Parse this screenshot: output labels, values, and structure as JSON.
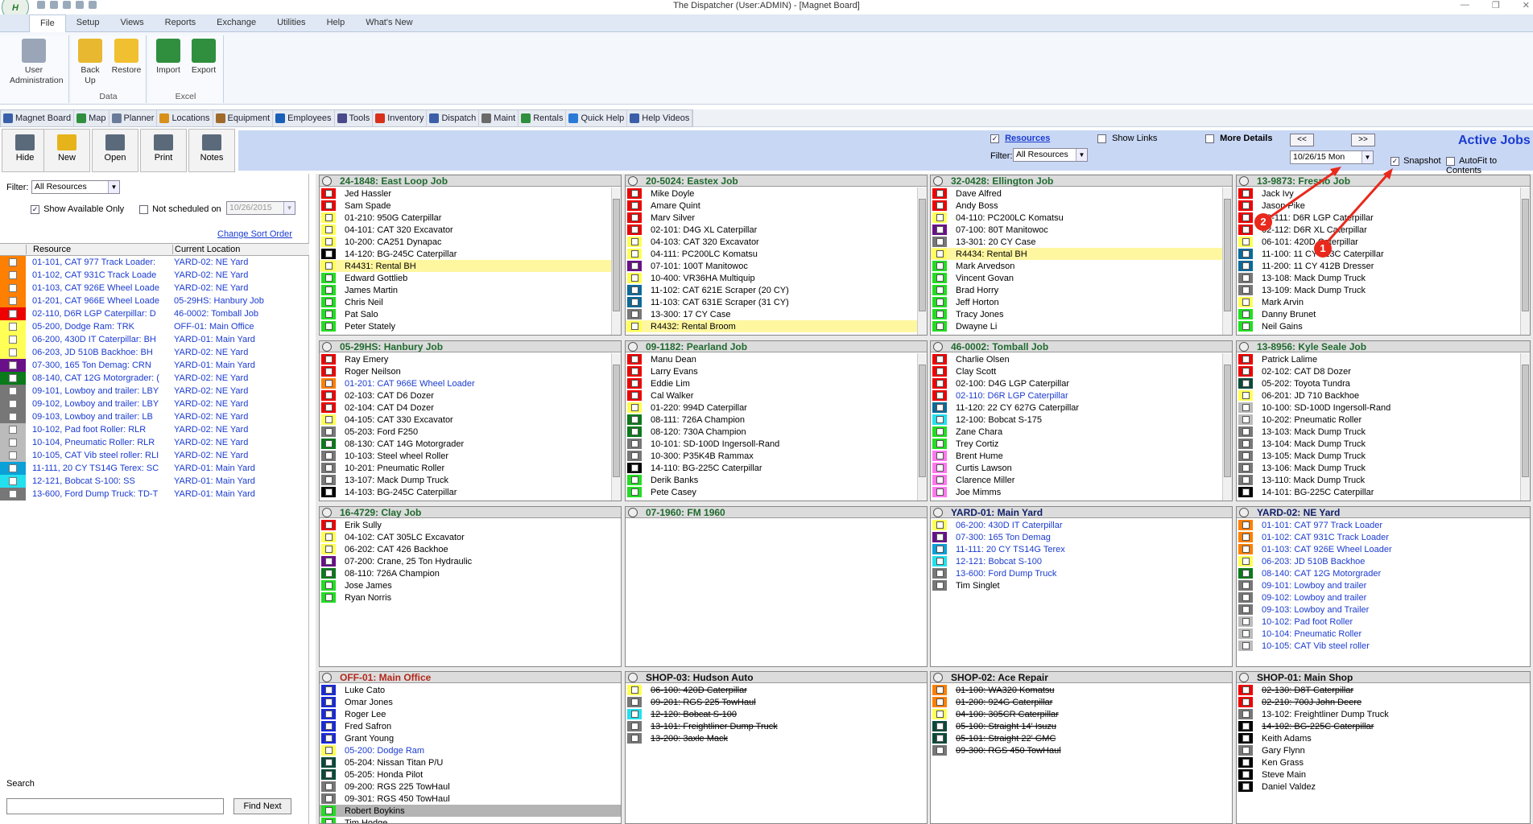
{
  "window": {
    "title": "The Dispatcher (User:ADMIN) - [Magnet Board]",
    "logo": "H"
  },
  "ribbon_tabs": [
    {
      "label": "File",
      "active": true
    },
    {
      "label": "Setup"
    },
    {
      "label": "Views"
    },
    {
      "label": "Reports"
    },
    {
      "label": "Exchange"
    },
    {
      "label": "Utilities"
    },
    {
      "label": "Help"
    },
    {
      "label": "What's New"
    }
  ],
  "ribbon": {
    "user_admin": "User Administration",
    "backup": "Back Up",
    "restore": "Restore",
    "group_data": "Data",
    "import": "Import",
    "export": "Export",
    "group_excel": "Excel"
  },
  "nav": [
    "Magnet Board",
    "Map",
    "Planner",
    "Locations",
    "Equipment",
    "Employees",
    "Tools",
    "Inventory",
    "Dispatch",
    "Maint",
    "Rentals",
    "Quick Help",
    "Help Videos"
  ],
  "toolbar": {
    "hide": "Hide",
    "new": "New",
    "open": "Open",
    "print": "Print",
    "notes": "Notes"
  },
  "header": {
    "resources_label": "Resources",
    "show_links": "Show Links",
    "more_details": "More Details",
    "filter_label": "Filter:",
    "filter_value": "All Resources",
    "prev": "<<",
    "next": ">>",
    "date": "10/26/15 Mon",
    "active_jobs": "Active Jobs",
    "snapshot": "Snapshot",
    "autofit": "AutoFit to Contents"
  },
  "annotations": [
    "1",
    "2"
  ],
  "left": {
    "filter_label": "Filter:",
    "filter_value": "All Resources",
    "show_available": "Show Available Only",
    "not_scheduled": "Not scheduled on",
    "not_scheduled_date": "10/26/2015",
    "change_sort": "Change Sort Order",
    "col_resource": "Resource",
    "col_location": "Current Location",
    "search_label": "Search",
    "find_next": "Find Next",
    "rows": [
      {
        "c": "#ff7f00",
        "name": "01-101, CAT 977 Track Loader:",
        "loc": "YARD-02: NE Yard"
      },
      {
        "c": "#ff7f00",
        "name": "01-102, CAT 931C Track Loade",
        "loc": "YARD-02: NE Yard"
      },
      {
        "c": "#ff7f00",
        "name": "01-103, CAT 926E Wheel Loade",
        "loc": "YARD-02: NE Yard"
      },
      {
        "c": "#ff7f00",
        "name": "01-201, CAT 966E Wheel Loade",
        "loc": "05-29HS: Hanbury Job"
      },
      {
        "c": "#ee0000",
        "name": "02-110, D6R LGP Caterpillar: D",
        "loc": "46-0002: Tomball Job"
      },
      {
        "c": "#ffff55",
        "name": "05-200, Dodge Ram: TRK",
        "loc": "OFF-01: Main Office"
      },
      {
        "c": "#ffff55",
        "name": "06-200, 430D IT Caterpillar: BH",
        "loc": "YARD-01: Main Yard"
      },
      {
        "c": "#ffff55",
        "name": "06-203, JD 510B Backhoe: BH",
        "loc": "YARD-02: NE Yard"
      },
      {
        "c": "#6a0f8a",
        "name": "07-300, 165 Ton Demag: CRN",
        "loc": "YARD-01: Main Yard"
      },
      {
        "c": "#0a7a1a",
        "name": "08-140, CAT 12G Motorgrader: (",
        "loc": "YARD-02: NE Yard"
      },
      {
        "c": "#777777",
        "name": "09-101, Lowboy and trailer: LBY",
        "loc": "YARD-02: NE Yard"
      },
      {
        "c": "#777777",
        "name": "09-102, Lowboy and trailer: LBY",
        "loc": "YARD-02: NE Yard"
      },
      {
        "c": "#777777",
        "name": "09-103, Lowboy and trailer: LB",
        "loc": "YARD-02: NE Yard"
      },
      {
        "c": "#bbbbbb",
        "name": "10-102, Pad foot Roller: RLR",
        "loc": "YARD-02: NE Yard"
      },
      {
        "c": "#bbbbbb",
        "name": "10-104, Pneumatic Roller: RLR",
        "loc": "YARD-02: NE Yard"
      },
      {
        "c": "#bbbbbb",
        "name": "10-105, CAT Vib steel roller: RLI",
        "loc": "YARD-02: NE Yard"
      },
      {
        "c": "#0aa0d8",
        "name": "11-111, 20 CY TS14G Terex: SC",
        "loc": "YARD-01: Main Yard"
      },
      {
        "c": "#22e0ee",
        "name": "12-121, Bobcat S-100: SS",
        "loc": "YARD-01: Main Yard"
      },
      {
        "c": "#777777",
        "name": "13-600, Ford Dump Truck: TD-T",
        "loc": "YARD-01: Main Yard"
      }
    ]
  },
  "jobs": [
    {
      "title": "24-1848: East Loop Job",
      "style": "green",
      "scroll": true,
      "rows": [
        {
          "c": "#ee0000",
          "t": "Jed Hassler"
        },
        {
          "c": "#ee0000",
          "t": "Sam Spade"
        },
        {
          "c": "#ffff55",
          "t": "01-210: 950G Caterpillar"
        },
        {
          "c": "#ffff55",
          "t": "04-101: CAT 320 Excavator"
        },
        {
          "c": "#ffff55",
          "t": "10-200: CA251 Dynapac"
        },
        {
          "c": "#000000",
          "t": "14-120: BG-245C Caterpillar"
        },
        {
          "c": "#ffff55",
          "t": "R4431: Rental BH",
          "hl": true
        },
        {
          "c": "#22dd22",
          "t": "Edward Gottlieb"
        },
        {
          "c": "#22dd22",
          "t": "James Martin"
        },
        {
          "c": "#22dd22",
          "t": "Chris Neil"
        },
        {
          "c": "#22dd22",
          "t": "Pat Salo"
        },
        {
          "c": "#22dd22",
          "t": "Peter Stately"
        }
      ]
    },
    {
      "title": "20-5024: Eastex Job",
      "style": "green",
      "scroll": true,
      "rows": [
        {
          "c": "#ee0000",
          "t": "Mike Doyle"
        },
        {
          "c": "#ee0000",
          "t": "Amare Quint"
        },
        {
          "c": "#ee0000",
          "t": "Marv Silver"
        },
        {
          "c": "#ee0000",
          "t": "02-101: D4G XL Caterpillar"
        },
        {
          "c": "#ffff55",
          "t": "04-103: CAT 320 Excavator"
        },
        {
          "c": "#ffff55",
          "t": "04-111: PC200LC Komatsu"
        },
        {
          "c": "#6a0f8a",
          "t": "07-101: 100T Manitowoc"
        },
        {
          "c": "#ffff55",
          "t": "10-400: VR36HA Multiquip"
        },
        {
          "c": "#0a6a9a",
          "t": "11-102: CAT 621E Scraper (20 CY)"
        },
        {
          "c": "#0a6a9a",
          "t": "11-103: CAT 631E Scraper (31 CY)"
        },
        {
          "c": "#777777",
          "t": "13-300: 17 CY Case"
        },
        {
          "c": "#ffff55",
          "t": "R4432: Rental Broom",
          "hl": true
        }
      ]
    },
    {
      "title": "32-0428: Ellington Job",
      "style": "green",
      "scroll": true,
      "rows": [
        {
          "c": "#ee0000",
          "t": "Dave Alfred"
        },
        {
          "c": "#ee0000",
          "t": "Andy Boss"
        },
        {
          "c": "#ffff55",
          "t": "04-110: PC200LC Komatsu"
        },
        {
          "c": "#6a0f8a",
          "t": "07-100: 80T Manitowoc"
        },
        {
          "c": "#777777",
          "t": "13-301: 20 CY Case"
        },
        {
          "c": "#ffff55",
          "t": "R4434: Rental BH",
          "hl": true
        },
        {
          "c": "#22dd22",
          "t": "Mark Arvedson"
        },
        {
          "c": "#22dd22",
          "t": "Vincent Govan"
        },
        {
          "c": "#22dd22",
          "t": "Brad Horry"
        },
        {
          "c": "#22dd22",
          "t": "Jeff Horton"
        },
        {
          "c": "#22dd22",
          "t": "Tracy Jones"
        },
        {
          "c": "#22dd22",
          "t": "Dwayne Li"
        }
      ]
    },
    {
      "title": "13-9873: Fresno Job",
      "style": "green",
      "scroll": true,
      "rows": [
        {
          "c": "#ee0000",
          "t": "Jack Ivy"
        },
        {
          "c": "#ee0000",
          "t": "Jason Pike"
        },
        {
          "c": "#ee0000",
          "t": "02-111: D6R LGP Caterpillar"
        },
        {
          "c": "#ee0000",
          "t": "02-112: D6R XL Caterpillar"
        },
        {
          "c": "#ffff55",
          "t": "06-101: 420D Caterpillar"
        },
        {
          "c": "#0a6a9a",
          "t": "11-100: 11 CY 613C Caterpillar"
        },
        {
          "c": "#0a6a9a",
          "t": "11-200: 11 CY 412B Dresser"
        },
        {
          "c": "#777777",
          "t": "13-108: Mack Dump Truck"
        },
        {
          "c": "#777777",
          "t": "13-109: Mack Dump Truck"
        },
        {
          "c": "#ffff55",
          "t": "Mark Arvin"
        },
        {
          "c": "#22dd22",
          "t": "Danny Brunet"
        },
        {
          "c": "#22dd22",
          "t": "Neil Gains"
        }
      ]
    },
    {
      "title": "05-29HS: Hanbury Job",
      "style": "green",
      "scroll": true,
      "rows": [
        {
          "c": "#ee0000",
          "t": "Ray Emery"
        },
        {
          "c": "#ee0000",
          "t": "Roger Neilson"
        },
        {
          "c": "#ff7f00",
          "t": "01-201: CAT 966E Wheel Loader",
          "blue": true
        },
        {
          "c": "#ee0000",
          "t": "02-103: CAT D6 Dozer"
        },
        {
          "c": "#ee0000",
          "t": "02-104: CAT D4 Dozer"
        },
        {
          "c": "#ffff55",
          "t": "04-105: CAT 330 Excavator"
        },
        {
          "c": "#777777",
          "t": "05-203: Ford F250"
        },
        {
          "c": "#0a7a1a",
          "t": "08-130: CAT 14G Motorgrader"
        },
        {
          "c": "#777777",
          "t": "10-103: Steel wheel Roller"
        },
        {
          "c": "#777777",
          "t": "10-201: Pneumatic Roller"
        },
        {
          "c": "#777777",
          "t": "13-107: Mack Dump Truck"
        },
        {
          "c": "#000000",
          "t": "14-103: BG-245C Caterpillar"
        }
      ]
    },
    {
      "title": "09-1182: Pearland Job",
      "style": "green",
      "scroll": true,
      "rows": [
        {
          "c": "#ee0000",
          "t": "Manu Dean"
        },
        {
          "c": "#ee0000",
          "t": "Larry Evans"
        },
        {
          "c": "#ee0000",
          "t": "Eddie Lim"
        },
        {
          "c": "#ee0000",
          "t": "Cal Walker"
        },
        {
          "c": "#ffff55",
          "t": "01-220: 994D Caterpillar"
        },
        {
          "c": "#0a7a1a",
          "t": "08-111: 726A Champion"
        },
        {
          "c": "#0a7a1a",
          "t": "08-120: 730A Champion"
        },
        {
          "c": "#777777",
          "t": "10-101: SD-100D Ingersoll-Rand"
        },
        {
          "c": "#777777",
          "t": "10-300: P35K4B Rammax"
        },
        {
          "c": "#000000",
          "t": "14-110: BG-225C Caterpillar"
        },
        {
          "c": "#22dd22",
          "t": "Derik Banks"
        },
        {
          "c": "#22dd22",
          "t": "Pete Casey"
        }
      ]
    },
    {
      "title": "46-0002: Tomball Job",
      "style": "green",
      "scroll": true,
      "rows": [
        {
          "c": "#ee0000",
          "t": "Charlie Olsen"
        },
        {
          "c": "#ee0000",
          "t": "Clay Scott"
        },
        {
          "c": "#ee0000",
          "t": "02-100: D4G LGP Caterpillar"
        },
        {
          "c": "#ee0000",
          "t": "02-110: D6R LGP Caterpillar",
          "blue": true
        },
        {
          "c": "#0a6a9a",
          "t": "11-120: 22 CY 627G Caterpillar"
        },
        {
          "c": "#22e0ee",
          "t": "12-100: Bobcat S-175"
        },
        {
          "c": "#22dd22",
          "t": "Zane Chara"
        },
        {
          "c": "#22dd22",
          "t": "Trey Cortiz"
        },
        {
          "c": "#ff77ee",
          "t": "Brent Hume"
        },
        {
          "c": "#ff77ee",
          "t": "Curtis Lawson"
        },
        {
          "c": "#ff77ee",
          "t": "Clarence Miller"
        },
        {
          "c": "#ff77ee",
          "t": "Joe Mimms"
        }
      ]
    },
    {
      "title": "13-8956: Kyle Seale Job",
      "style": "green",
      "scroll": true,
      "rows": [
        {
          "c": "#ee0000",
          "t": "Patrick Lalime"
        },
        {
          "c": "#ee0000",
          "t": "02-102: CAT D8 Dozer"
        },
        {
          "c": "#0a4a3a",
          "t": "05-202: Toyota Tundra"
        },
        {
          "c": "#ffff55",
          "t": "06-201: JD 710 Backhoe"
        },
        {
          "c": "#bbbbbb",
          "t": "10-100: SD-100D Ingersoll-Rand"
        },
        {
          "c": "#bbbbbb",
          "t": "10-202: Pneumatic Roller"
        },
        {
          "c": "#777777",
          "t": "13-103: Mack Dump Truck"
        },
        {
          "c": "#777777",
          "t": "13-104: Mack Dump Truck"
        },
        {
          "c": "#777777",
          "t": "13-105: Mack Dump Truck"
        },
        {
          "c": "#777777",
          "t": "13-106: Mack Dump Truck"
        },
        {
          "c": "#777777",
          "t": "13-110: Mack Dump Truck"
        },
        {
          "c": "#000000",
          "t": "14-101: BG-225C Caterpillar"
        }
      ]
    },
    {
      "title": "16-4729: Clay Job",
      "style": "green",
      "rows": [
        {
          "c": "#ee0000",
          "t": "Erik Sully"
        },
        {
          "c": "#ffff55",
          "t": "04-102: CAT 305LC Excavator"
        },
        {
          "c": "#ffff55",
          "t": "06-202: CAT 426 Backhoe"
        },
        {
          "c": "#6a0f8a",
          "t": "07-200: Crane, 25 Ton Hydraulic"
        },
        {
          "c": "#0a7a1a",
          "t": "08-110: 726A Champion"
        },
        {
          "c": "#22dd22",
          "t": "Jose James"
        },
        {
          "c": "#22dd22",
          "t": "Ryan Norris"
        }
      ]
    },
    {
      "title": "07-1960: FM 1960",
      "style": "green",
      "rows": []
    },
    {
      "title": "YARD-01: Main Yard",
      "style": "blue",
      "rows": [
        {
          "c": "#ffff55",
          "t": "06-200: 430D IT Caterpillar",
          "blue": true
        },
        {
          "c": "#6a0f8a",
          "t": "07-300: 165 Ton Demag",
          "blue": true
        },
        {
          "c": "#0aa0d8",
          "t": "11-111: 20 CY TS14G Terex",
          "blue": true
        },
        {
          "c": "#22e0ee",
          "t": "12-121: Bobcat S-100",
          "blue": true
        },
        {
          "c": "#777777",
          "t": "13-600: Ford Dump Truck",
          "blue": true
        },
        {
          "c": "#777777",
          "t": "Tim Singlet"
        }
      ]
    },
    {
      "title": "YARD-02: NE Yard",
      "style": "blue",
      "rows": [
        {
          "c": "#ff7f00",
          "t": "01-101: CAT 977 Track Loader",
          "blue": true
        },
        {
          "c": "#ff7f00",
          "t": "01-102: CAT 931C Track Loader",
          "blue": true
        },
        {
          "c": "#ff7f00",
          "t": "01-103: CAT 926E Wheel Loader",
          "blue": true
        },
        {
          "c": "#ffff55",
          "t": "06-203: JD 510B Backhoe",
          "blue": true
        },
        {
          "c": "#0a7a1a",
          "t": "08-140: CAT 12G Motorgrader",
          "blue": true
        },
        {
          "c": "#777777",
          "t": "09-101: Lowboy and trailer",
          "blue": true
        },
        {
          "c": "#777777",
          "t": "09-102: Lowboy and trailer",
          "blue": true
        },
        {
          "c": "#777777",
          "t": "09-103: Lowboy and Trailer",
          "blue": true
        },
        {
          "c": "#bbbbbb",
          "t": "10-102: Pad foot Roller",
          "blue": true
        },
        {
          "c": "#bbbbbb",
          "t": "10-104: Pneumatic Roller",
          "blue": true
        },
        {
          "c": "#bbbbbb",
          "t": "10-105: CAT Vib steel roller",
          "blue": true
        }
      ]
    },
    {
      "title": "OFF-01: Main Office",
      "style": "red",
      "rows": [
        {
          "c": "#1a2ad8",
          "t": "Luke Cato"
        },
        {
          "c": "#1a2ad8",
          "t": "Omar Jones"
        },
        {
          "c": "#1a2ad8",
          "t": "Roger Lee"
        },
        {
          "c": "#1a2ad8",
          "t": "Fred Safron"
        },
        {
          "c": "#1a2ad8",
          "t": "Grant Young"
        },
        {
          "c": "#ffff55",
          "t": "05-200: Dodge Ram",
          "blue": true
        },
        {
          "c": "#0a4a3a",
          "t": "05-204: Nissan Titan P/U"
        },
        {
          "c": "#0a4a3a",
          "t": "05-205: Honda Pilot"
        },
        {
          "c": "#777777",
          "t": "09-200: RGS 225 TowHaul"
        },
        {
          "c": "#777777",
          "t": "09-301: RGS 450 TowHaul"
        },
        {
          "c": "#22dd22",
          "t": "Robert Boykins",
          "gray": true
        },
        {
          "c": "#22dd22",
          "t": "Tim Hodge"
        }
      ]
    },
    {
      "title": "SHOP-03: Hudson Auto",
      "style": "dark",
      "rows": [
        {
          "c": "#ffff55",
          "t": "06-100: 420D Caterpillar",
          "strike": true
        },
        {
          "c": "#777777",
          "t": "09-201: RGS 225 TowHaul",
          "strike": true
        },
        {
          "c": "#22e0ee",
          "t": "12-120: Bobcat S-100",
          "strike": true
        },
        {
          "c": "#777777",
          "t": "13-101: Freightliner Dump Truck",
          "strike": true
        },
        {
          "c": "#777777",
          "t": "13-200: 3axle Mack",
          "strike": true
        }
      ]
    },
    {
      "title": "SHOP-02: Ace Repair",
      "style": "dark",
      "rows": [
        {
          "c": "#ff7f00",
          "t": "01-100: WA320 Komatsu",
          "strike": true
        },
        {
          "c": "#ff7f00",
          "t": "01-200: 924G Caterpillar",
          "strike": true
        },
        {
          "c": "#ffff55",
          "t": "04-100: 305CR Caterpillar",
          "strike": true
        },
        {
          "c": "#0a4a3a",
          "t": "05-100: Straight 14' Isuzu",
          "strike": true
        },
        {
          "c": "#0a4a3a",
          "t": "05-101: Straight 22' GMC",
          "strike": true
        },
        {
          "c": "#777777",
          "t": "09-300: RGS 450 TowHaul",
          "strike": true
        }
      ]
    },
    {
      "title": "SHOP-01: Main Shop",
      "style": "dark",
      "rows": [
        {
          "c": "#ee0000",
          "t": "02-130: D8T Caterpillar",
          "strike": true
        },
        {
          "c": "#ee0000",
          "t": "02-210: 700J John Deere",
          "strike": true
        },
        {
          "c": "#777777",
          "t": "13-102: Freightliner Dump Truck"
        },
        {
          "c": "#000000",
          "t": "14-102: BG-225C Caterpillar",
          "strike": true
        },
        {
          "c": "#000000",
          "t": "Keith Adams"
        },
        {
          "c": "#777777",
          "t": "Gary Flynn"
        },
        {
          "c": "#000000",
          "t": "Ken Grass"
        },
        {
          "c": "#000000",
          "t": "Steve Main"
        },
        {
          "c": "#000000",
          "t": "Daniel Valdez"
        }
      ]
    }
  ]
}
